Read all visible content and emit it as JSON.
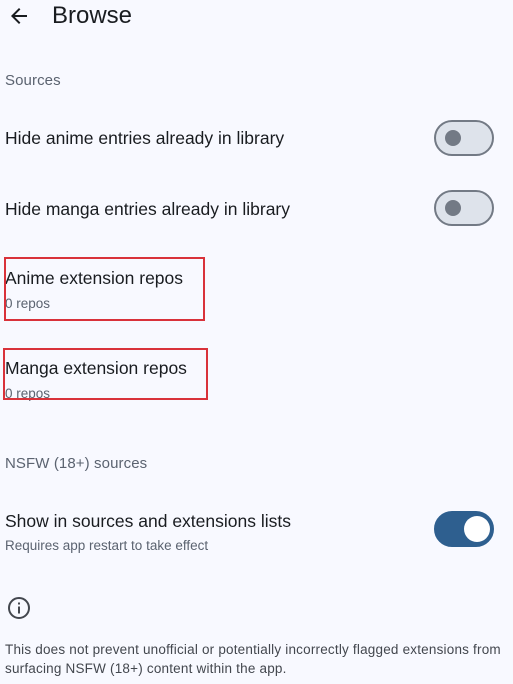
{
  "header": {
    "title": "Browse",
    "back_icon": "arrow-back-icon"
  },
  "sections": {
    "sources": "Sources",
    "nsfw": "NSFW (18+) sources"
  },
  "settings": {
    "hide_anime": {
      "title": "Hide anime entries already in library",
      "enabled": false
    },
    "hide_manga": {
      "title": "Hide manga entries already in library",
      "enabled": false
    },
    "anime_repos": {
      "title": "Anime extension repos",
      "subtitle": "0 repos"
    },
    "manga_repos": {
      "title": "Manga extension repos",
      "subtitle": "0 repos"
    },
    "show_nsfw": {
      "title": "Show in sources and extensions lists",
      "subtitle": "Requires app restart to take effect",
      "enabled": true
    }
  },
  "info": {
    "icon": "info-icon",
    "text": "This does not prevent unofficial or potentially incorrectly flagged extensions from surfacing NSFW (18+) content within the app."
  },
  "colors": {
    "background": "#f8f9ff",
    "accent": "#2e5f8f",
    "highlight": "#d9323a"
  }
}
